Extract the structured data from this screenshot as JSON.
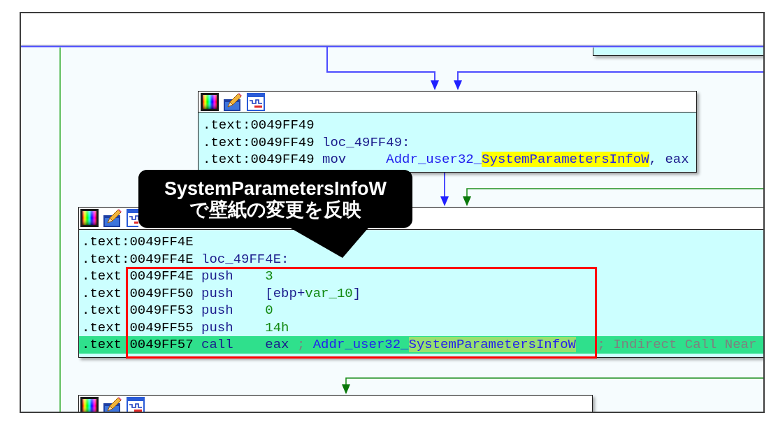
{
  "graph": {
    "blocks": [
      {
        "lines": [
          {
            "address": ".text:0049FF49",
            "selected": false
          },
          {
            "address": ".text:0049FF49",
            "label": "loc_49FF49:",
            "selected": false
          },
          {
            "address": ".text:0049FF49",
            "mnemonic": "mov",
            "operands": [
              {
                "text": "Addr_user32_",
                "kind": "name",
                "highlighted": false
              },
              {
                "text": "SystemParametersInfoW",
                "kind": "name",
                "highlighted": true
              },
              {
                "text": ", ",
                "kind": "punct",
                "highlighted": false
              },
              {
                "text": "eax",
                "kind": "register",
                "highlighted": false
              }
            ],
            "selected": false
          }
        ]
      },
      {
        "lines": [
          {
            "address": ".text:0049FF4E",
            "selected": false
          },
          {
            "address": ".text:0049FF4E",
            "label": "loc_49FF4E:",
            "selected": false
          },
          {
            "segment": ".text",
            "address": "0049FF4E",
            "mnemonic": "push",
            "operands": [
              {
                "text": "3",
                "kind": "number",
                "highlighted": false
              }
            ],
            "selected": false
          },
          {
            "segment": ".text",
            "address": "0049FF50",
            "mnemonic": "push",
            "operands": [
              {
                "text": "[",
                "kind": "punct",
                "highlighted": false
              },
              {
                "text": "ebp",
                "kind": "register",
                "highlighted": false
              },
              {
                "text": "+",
                "kind": "punct",
                "highlighted": false
              },
              {
                "text": "var_10",
                "kind": "variable",
                "highlighted": false
              },
              {
                "text": "]",
                "kind": "punct",
                "highlighted": false
              }
            ],
            "selected": false
          },
          {
            "segment": ".text",
            "address": "0049FF53",
            "mnemonic": "push",
            "operands": [
              {
                "text": "0",
                "kind": "number",
                "highlighted": false
              }
            ],
            "selected": false
          },
          {
            "segment": ".text",
            "address": "0049FF55",
            "mnemonic": "push",
            "operands": [
              {
                "text": "14h",
                "kind": "number",
                "highlighted": false
              }
            ],
            "selected": false
          },
          {
            "segment": ".text",
            "address": "0049FF57",
            "mnemonic": "call",
            "operands": [
              {
                "text": "eax ",
                "kind": "register",
                "highlighted": false
              },
              {
                "text": "; ",
                "kind": "comment",
                "highlighted": false
              },
              {
                "text": "Addr_user32_",
                "kind": "name",
                "highlighted": false
              },
              {
                "text": "SystemParametersInfoW",
                "kind": "name",
                "highlighted": true
              }
            ],
            "comment": "; Indirect Call Near",
            "selected": true
          }
        ]
      }
    ]
  },
  "callout": {
    "lines": [
      "SystemParametersInfoW",
      "で壁紙の変更を反映"
    ]
  }
}
